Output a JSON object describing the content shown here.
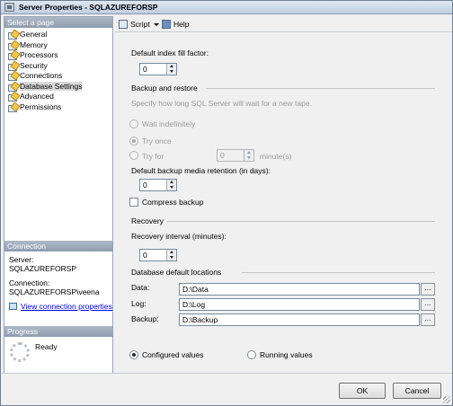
{
  "window": {
    "title": "Server Properties - SQLAZUREFORSP"
  },
  "sidebar": {
    "header": "Select a page",
    "items": [
      {
        "label": "General"
      },
      {
        "label": "Memory"
      },
      {
        "label": "Processors"
      },
      {
        "label": "Security"
      },
      {
        "label": "Connections"
      },
      {
        "label": "Database Settings",
        "selected": true
      },
      {
        "label": "Advanced"
      },
      {
        "label": "Permissions"
      }
    ]
  },
  "connection": {
    "header": "Connection",
    "server_label": "Server:",
    "server_value": "SQLAZUREFORSP",
    "connection_label": "Connection:",
    "connection_value": "SQLAZUREFORSP\\veena",
    "view_link": "View connection properties"
  },
  "progress": {
    "header": "Progress",
    "status": "Ready"
  },
  "toolbar": {
    "script_label": "Script",
    "help_label": "Help"
  },
  "settings": {
    "fill_factor_label": "Default index fill factor:",
    "fill_factor_value": "0",
    "backup_section": "Backup and restore",
    "backup_hint": "Specify how long SQL Server will wait for a new tape.",
    "wait_indefinitely": "Wait indefinitely",
    "try_once": "Try once",
    "try_for": "Try for",
    "try_for_value": "0",
    "minutes_label": "minute(s)",
    "retention_label": "Default backup media retention (in days):",
    "retention_value": "0",
    "compress_label": "Compress backup",
    "recovery_section": "Recovery",
    "recovery_label": "Recovery interval (minutes):",
    "recovery_value": "0",
    "locations_section": "Database default locations",
    "data_label": "Data:",
    "data_value": "D:\\Data",
    "log_label": "Log:",
    "log_value": "D:\\Log",
    "backup_label": "Backup:",
    "backup_value": "D:\\Backup",
    "browse": "...",
    "configured_values": "Configured values",
    "running_values": "Running values"
  },
  "buttons": {
    "ok": "OK",
    "cancel": "Cancel"
  }
}
